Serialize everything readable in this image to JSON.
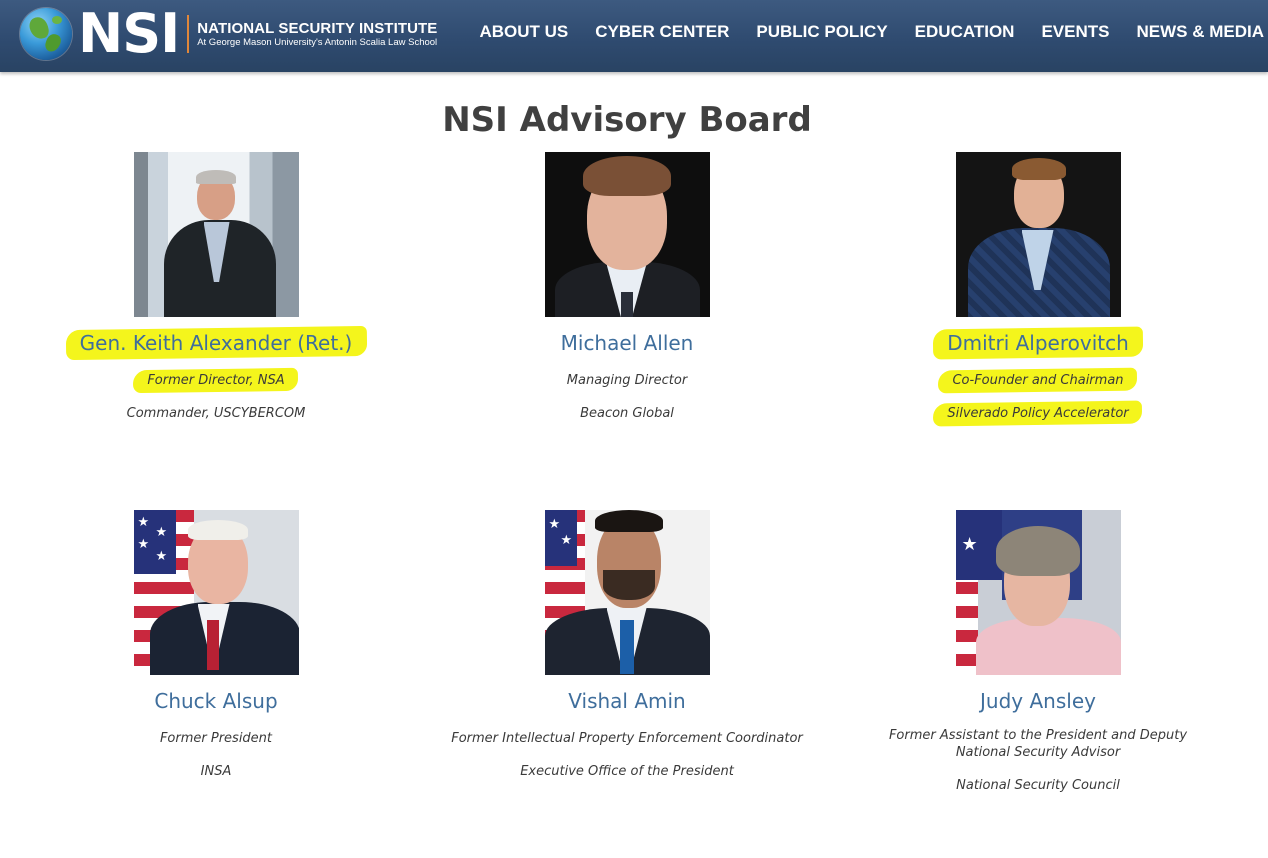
{
  "site": {
    "logo_text": "NSI",
    "logo_line1": "NATIONAL SECURITY INSTITUTE",
    "logo_line2": "At George Mason University's Antonin Scalia Law School"
  },
  "nav": {
    "items": [
      {
        "label": "ABOUT US"
      },
      {
        "label": "CYBER CENTER"
      },
      {
        "label": "PUBLIC POLICY"
      },
      {
        "label": "EDUCATION"
      },
      {
        "label": "EVENTS"
      },
      {
        "label": "NEWS & MEDIA"
      }
    ]
  },
  "page": {
    "title": "NSI Advisory Board"
  },
  "members": [
    {
      "name": "Gen. Keith Alexander (Ret.)",
      "role1": "Former Director, NSA",
      "role2": "Commander, USCYBERCOM"
    },
    {
      "name": "Michael Allen",
      "role1": "Managing Director",
      "role2": "Beacon Global"
    },
    {
      "name": "Dmitri Alperovitch",
      "role1": "Co-Founder and Chairman",
      "role2": "Silverado Policy Accelerator"
    },
    {
      "name": "Chuck Alsup",
      "role1": "Former President",
      "role2": "INSA"
    },
    {
      "name": "Vishal Amin",
      "role1": "Former Intellectual Property Enforcement Coordinator",
      "role2": "Executive Office of the President"
    },
    {
      "name": "Judy Ansley",
      "role1": "Former Assistant to the President and Deputy National Security Advisor",
      "role2": "National Security Council"
    }
  ],
  "colors": {
    "header": "#2f4b70",
    "link_blue": "#3f6e9c",
    "highlight": "#f4f51c",
    "title_text": "#404040"
  }
}
